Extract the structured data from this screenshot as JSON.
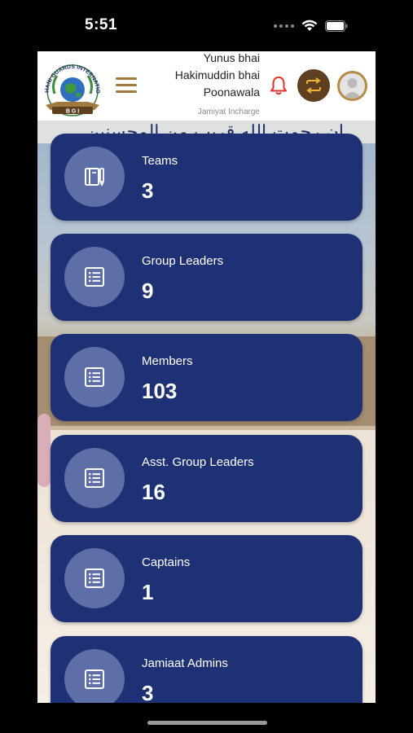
{
  "status_bar": {
    "time": "5:51"
  },
  "header": {
    "logo_text": "BURHANI GUARDS INTERNATIONAL",
    "user_name_line1": "Yunus bhai",
    "user_name_line2": "Hakimuddin bhai",
    "user_name_line3": "Poonawala",
    "user_role": "Jamiyat Incharge"
  },
  "background": {
    "arabic_text": "إن رحمت الله قريب من المحسنين"
  },
  "cards": [
    {
      "label": "Teams",
      "value": "3",
      "icon": "notebook-icon"
    },
    {
      "label": "Group Leaders",
      "value": "9",
      "icon": "list-icon"
    },
    {
      "label": "Members",
      "value": "103",
      "icon": "list-icon"
    },
    {
      "label": "Asst. Group Leaders",
      "value": "16",
      "icon": "list-icon"
    },
    {
      "label": "Captains",
      "value": "1",
      "icon": "list-icon"
    },
    {
      "label": "Jamiaat Admins",
      "value": "3",
      "icon": "list-icon"
    }
  ],
  "colors": {
    "card_bg": "#1f3175",
    "icon_circle": "#5e6ea6",
    "accent_brown": "#5e4020",
    "accent_gold": "#b88a45",
    "bell_red": "#e0322d"
  }
}
